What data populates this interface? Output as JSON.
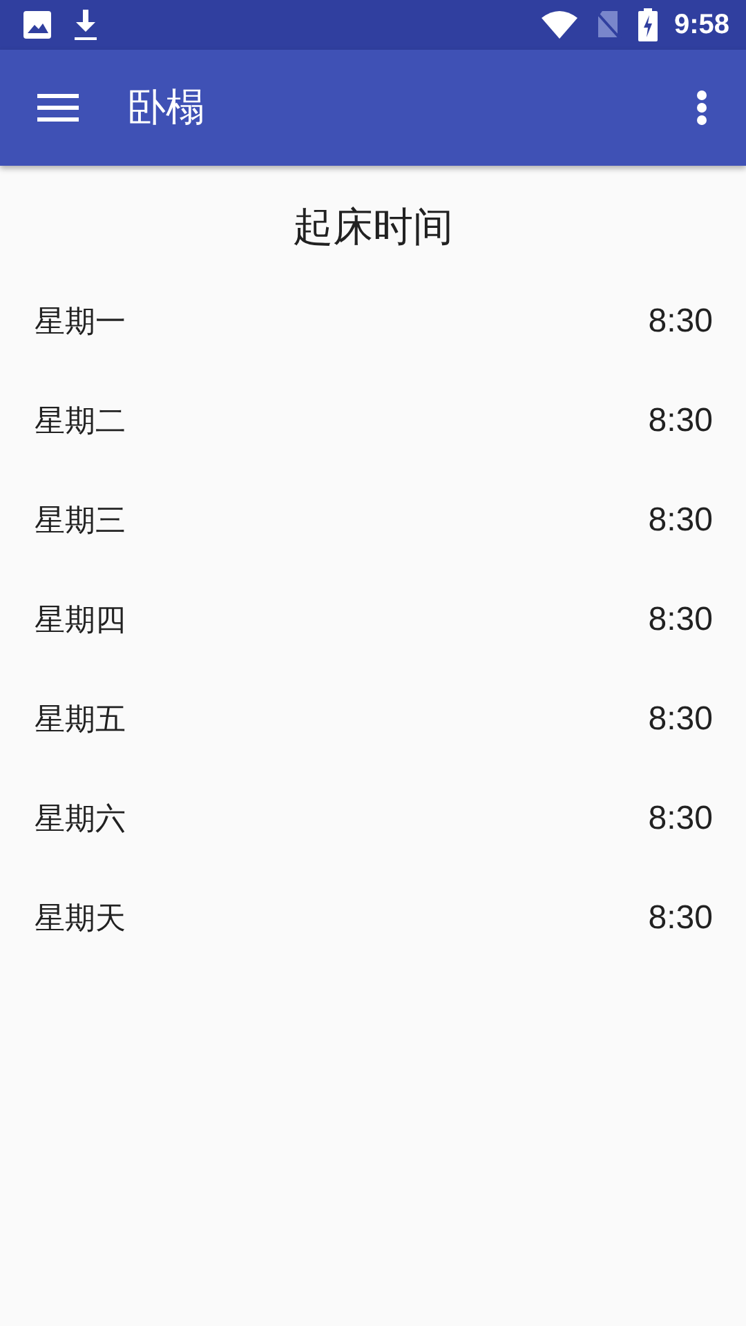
{
  "status_bar": {
    "time": "9:58"
  },
  "app_bar": {
    "title": "卧榻"
  },
  "heading": "起床时间",
  "rows": [
    {
      "day": "星期一",
      "time": "8:30"
    },
    {
      "day": "星期二",
      "time": "8:30"
    },
    {
      "day": "星期三",
      "time": "8:30"
    },
    {
      "day": "星期四",
      "time": "8:30"
    },
    {
      "day": "星期五",
      "time": "8:30"
    },
    {
      "day": "星期六",
      "time": "8:30"
    },
    {
      "day": "星期天",
      "time": "8:30"
    }
  ]
}
